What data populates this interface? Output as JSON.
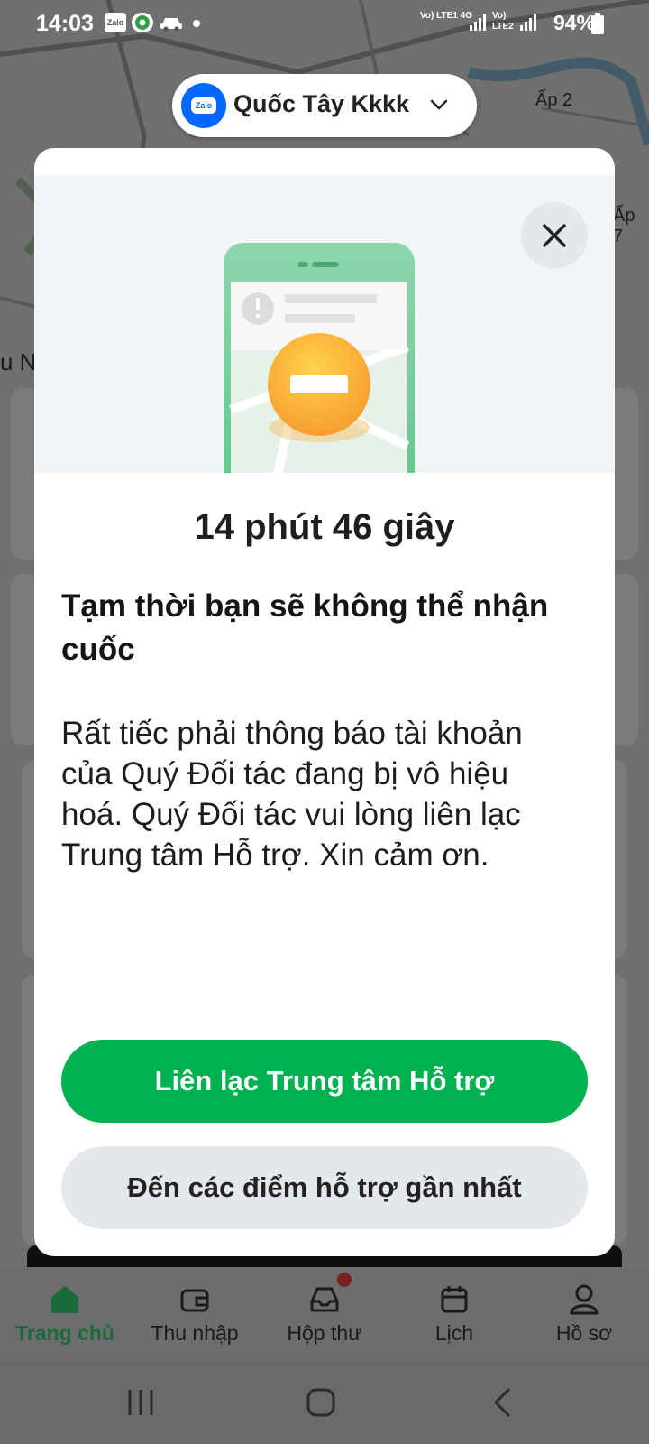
{
  "status_bar": {
    "time": "14:03",
    "app_icon_zalo": "Zalo",
    "network_1": "Vo) LTE1 4G",
    "network_2": "Vo) LTE2",
    "battery": "94%"
  },
  "map": {
    "labels": [
      "Ấp 2",
      "Ấp 7",
      "u N"
    ]
  },
  "account": {
    "logo_text": "Zalo",
    "name": "Quốc Tây  Kkkk"
  },
  "modal": {
    "timer": "14 phút 46 giây",
    "title": "Tạm thời bạn sẽ không thể nhận cuốc",
    "body": "Rất tiếc phải thông báo tài khoản của Quý Đối tác đang bị vô hiệu hoá. Quý Đối tác vui lòng liên lạc Trung tâm Hỗ trợ. Xin cảm ơn.",
    "primary_button": "Liên lạc Trung tâm Hỗ trợ",
    "secondary_button": "Đến các điểm hỗ trợ gần nhất"
  },
  "bottom_nav": {
    "items": [
      {
        "label": "Trang chủ",
        "icon": "home-icon",
        "active": true
      },
      {
        "label": "Thu nhập",
        "icon": "wallet-icon",
        "active": false
      },
      {
        "label": "Hộp thư",
        "icon": "inbox-icon",
        "active": false,
        "badge": true
      },
      {
        "label": "Lịch",
        "icon": "calendar-icon",
        "active": false
      },
      {
        "label": "Hồ sơ",
        "icon": "profile-icon",
        "active": false
      }
    ]
  },
  "colors": {
    "primary_green": "#00b14f",
    "active_nav": "#1a6b3a",
    "zalo_blue": "#0068ff",
    "secondary_button_bg": "#e4e7eb"
  }
}
